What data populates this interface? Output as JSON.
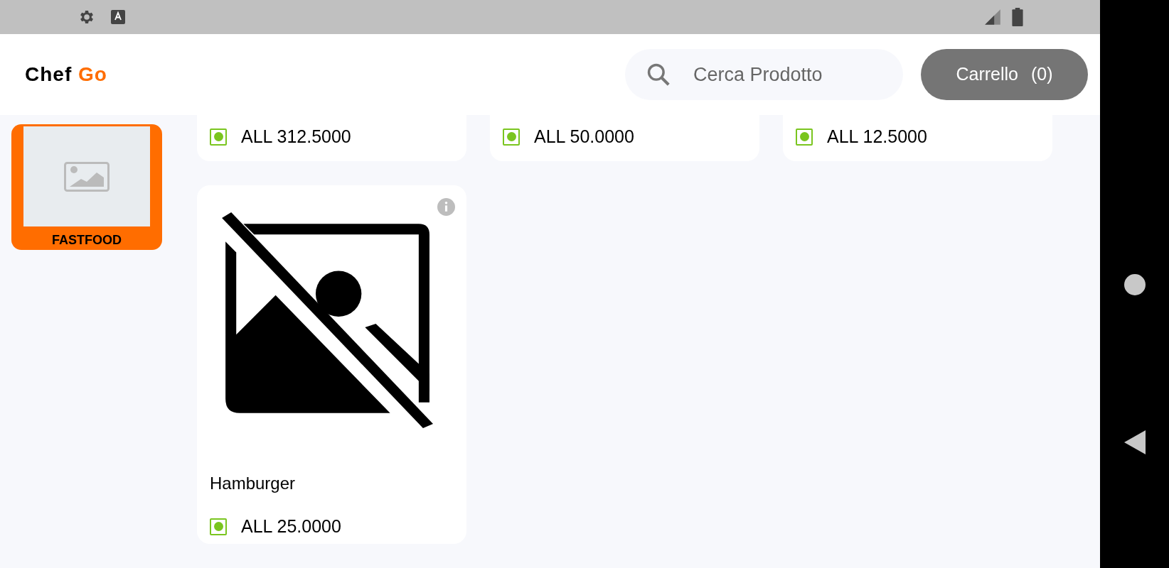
{
  "header": {
    "logo": {
      "part_1": "Chef",
      "part_2": "Go"
    },
    "search": {
      "placeholder": "Cerca Prodotto"
    },
    "cart_button": {
      "label": "Carrello",
      "count": "(0)"
    }
  },
  "categories": [
    {
      "name": "FASTFOOD",
      "selected": true
    }
  ],
  "partial_products": [
    {
      "price": "ALL 312.5000",
      "veg": true
    },
    {
      "price": "ALL 50.0000",
      "veg": true
    },
    {
      "price": "ALL 12.5000",
      "veg": true
    }
  ],
  "products": [
    {
      "name": "Hamburger",
      "price": "ALL 25.0000",
      "veg": true
    }
  ]
}
